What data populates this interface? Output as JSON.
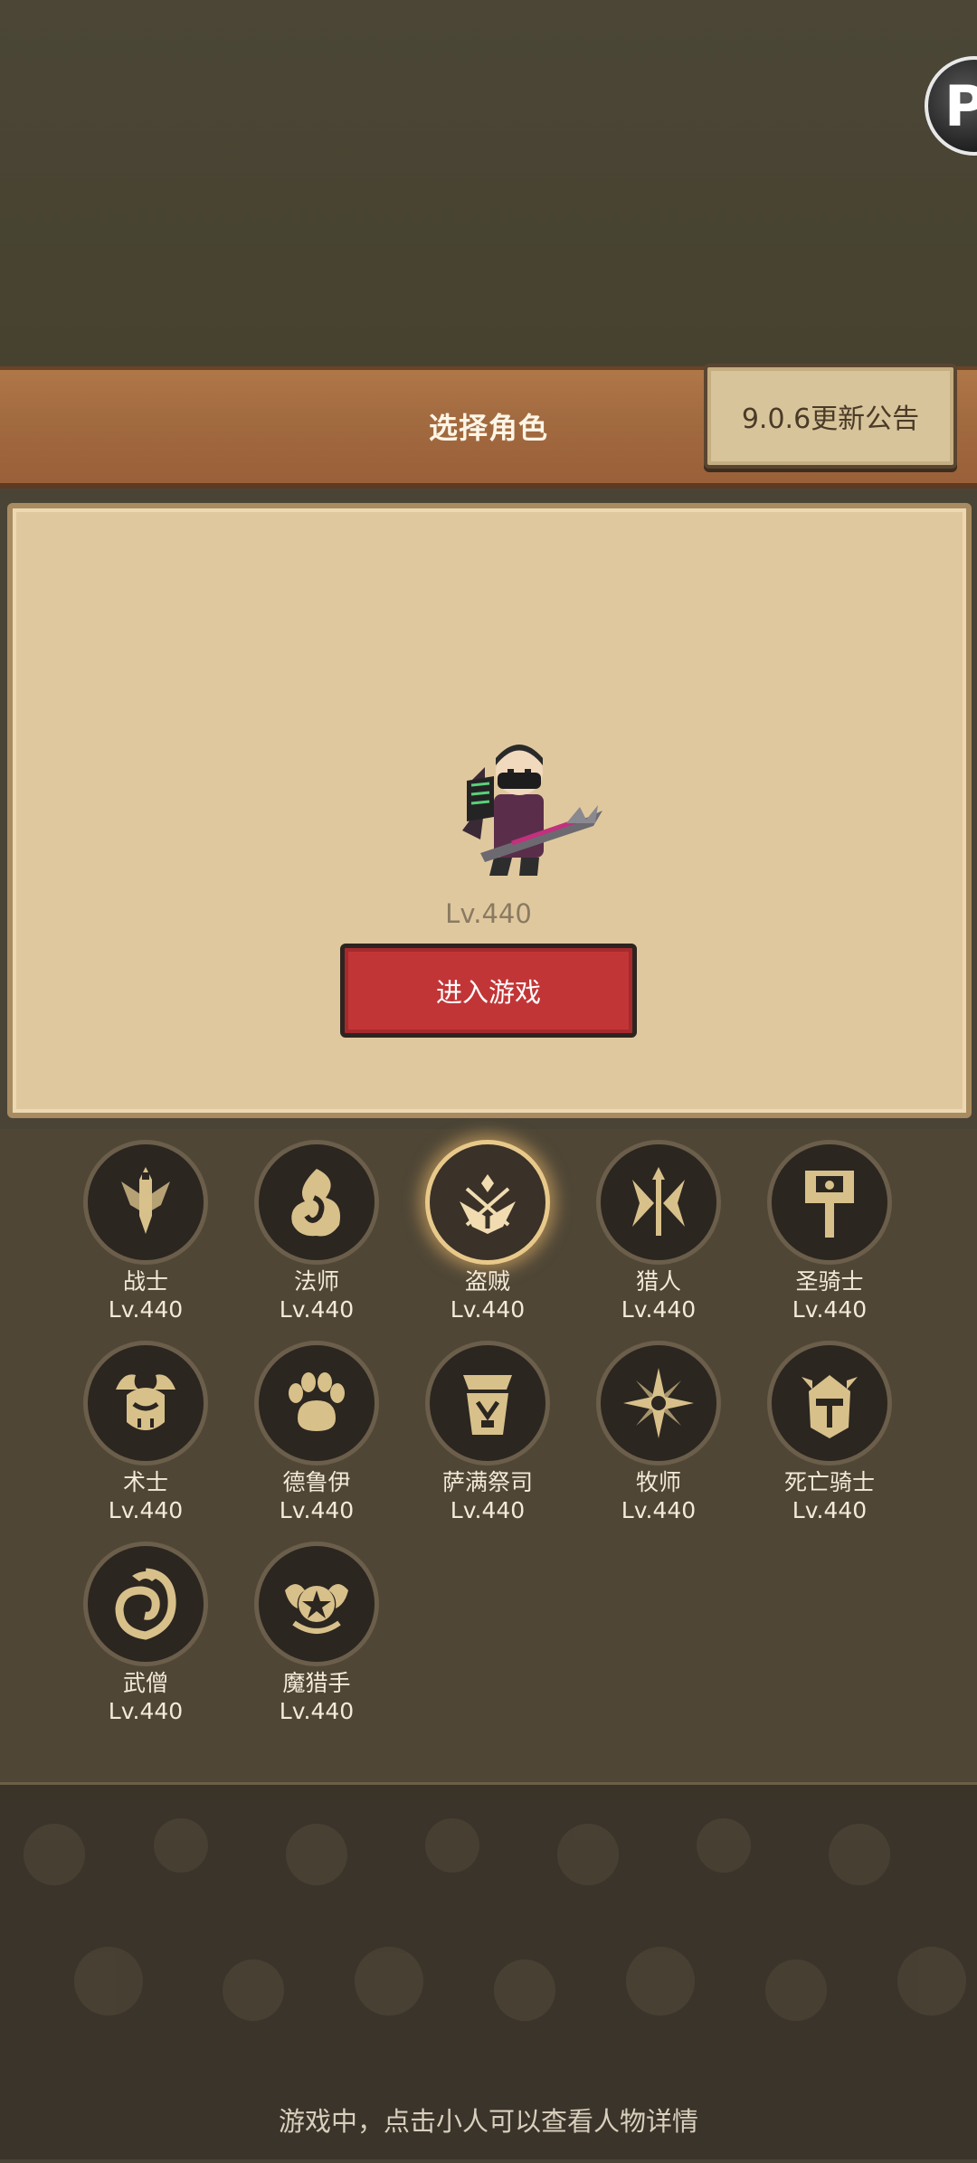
{
  "header": {
    "title": "选择角色",
    "notice_button": "9.0.6更新公告",
    "badge_letter": "P"
  },
  "hero": {
    "level": "Lv.440",
    "enter_button": "进入游戏"
  },
  "classes": [
    {
      "name": "战士",
      "level": "Lv.440",
      "icon": "warrior-sword-icon"
    },
    {
      "name": "法师",
      "level": "Lv.440",
      "icon": "mage-flame-icon"
    },
    {
      "name": "盗贼",
      "level": "Lv.440",
      "icon": "rogue-daggers-icon",
      "selected": true
    },
    {
      "name": "猎人",
      "level": "Lv.440",
      "icon": "hunter-arrows-icon"
    },
    {
      "name": "圣骑士",
      "level": "Lv.440",
      "icon": "paladin-hammer-icon"
    },
    {
      "name": "术士",
      "level": "Lv.440",
      "icon": "warlock-skull-icon"
    },
    {
      "name": "德鲁伊",
      "level": "Lv.440",
      "icon": "druid-paw-icon"
    },
    {
      "name": "萨满祭司",
      "level": "Lv.440",
      "icon": "shaman-totem-icon"
    },
    {
      "name": "牧师",
      "level": "Lv.440",
      "icon": "priest-star-icon"
    },
    {
      "name": "死亡骑士",
      "level": "Lv.440",
      "icon": "deathknight-helm-icon"
    },
    {
      "name": "武僧",
      "level": "Lv.440",
      "icon": "monk-swirl-icon"
    },
    {
      "name": "魔猎手",
      "level": "Lv.440",
      "icon": "demonhunter-emblem-icon"
    }
  ],
  "footer": {
    "hint": "游戏中，点击小人可以查看人物详情"
  },
  "colors": {
    "accent_gold": "#d8c08a",
    "enter_red": "#c23537",
    "parchment": "#e0c89e"
  }
}
